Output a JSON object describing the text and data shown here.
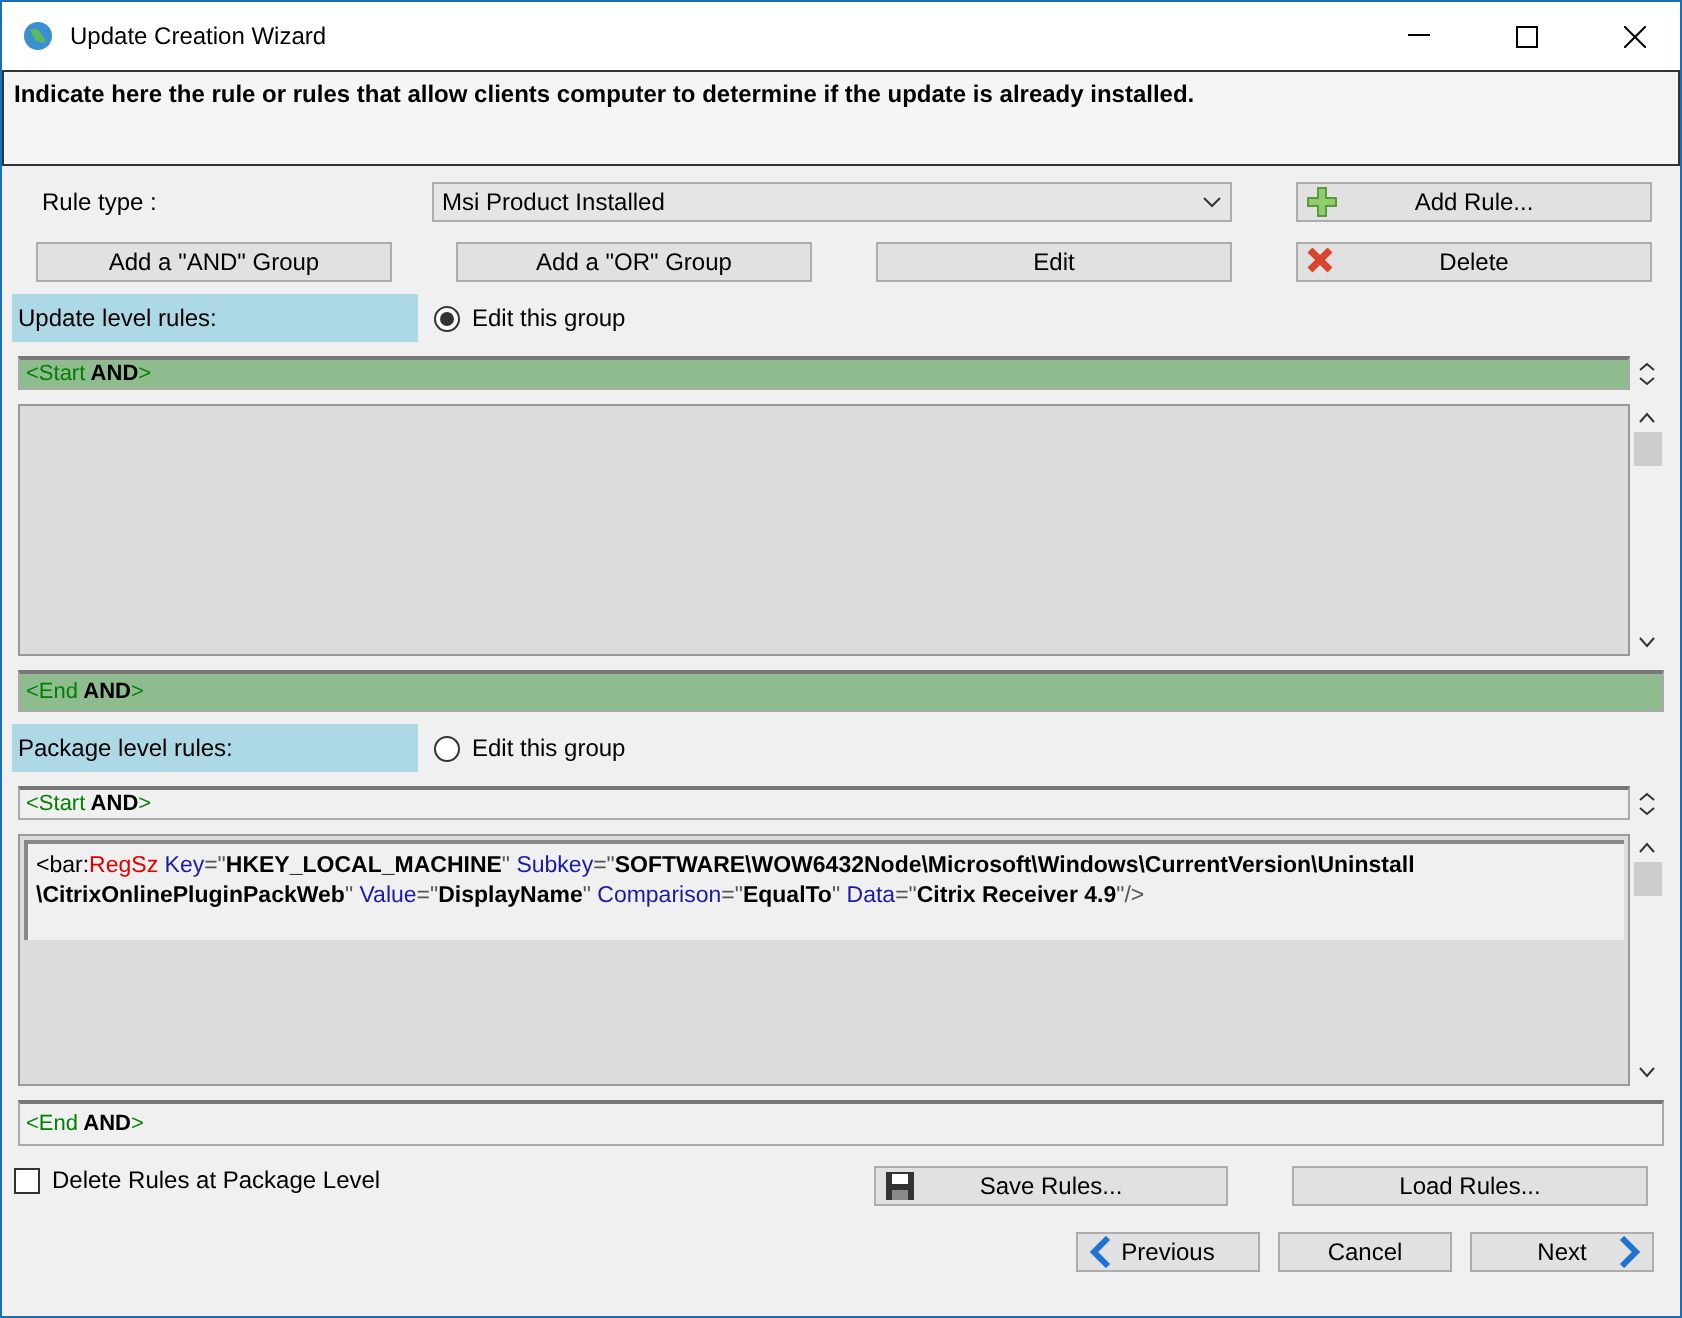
{
  "window": {
    "title": "Update Creation Wizard"
  },
  "instruction": "Indicate here the rule or rules that allow clients computer to determine if the update is already installed.",
  "rule_type": {
    "label": "Rule type :",
    "value": "Msi Product Installed"
  },
  "buttons": [
    {
      "label": "Add Rule..."
    },
    {
      "label": "Add a \"AND\" Group"
    },
    {
      "label": "Add a \"OR\" Group"
    },
    {
      "label": "Edit"
    },
    {
      "label": "Delete"
    }
  ],
  "groups": [
    {
      "label": "Update level rules:",
      "radio": "Edit this group",
      "selected": true,
      "start": [
        {
          "kind": "punct",
          "text": "<Start"
        },
        {
          "kind": "op",
          "text": " AND"
        },
        {
          "kind": "punct",
          "text": ">"
        }
      ],
      "end": [
        {
          "kind": "punct",
          "text": "<End"
        },
        {
          "kind": "op",
          "text": " AND"
        },
        {
          "kind": "punct",
          "text": ">"
        }
      ]
    },
    {
      "label": "Package level rules:",
      "radio": "Edit this group",
      "selected": false,
      "start": [
        {
          "kind": "punct",
          "text": "<Start"
        },
        {
          "kind": "op",
          "text": " AND"
        },
        {
          "kind": "punct",
          "text": ">"
        }
      ],
      "end": [
        {
          "kind": "punct",
          "text": "<End"
        },
        {
          "kind": "op",
          "text": " AND"
        },
        {
          "kind": "punct",
          "text": ">"
        }
      ],
      "rules": [
        [
          {
            "kind": "tag",
            "text": "<bar:"
          },
          {
            "kind": "type",
            "text": "RegSz"
          },
          {
            "kind": "attr",
            "text": " Key"
          },
          {
            "kind": "quote",
            "text": "=\""
          },
          {
            "kind": "value",
            "text": "HKEY_LOCAL_MACHINE"
          },
          {
            "kind": "quote",
            "text": "\""
          },
          {
            "kind": "attr",
            "text": " Subkey"
          },
          {
            "kind": "quote",
            "text": "=\""
          },
          {
            "kind": "value",
            "text": "SOFTWARE\\WOW6432Node\\Microsoft\\Windows\\CurrentVersion\\Uninstall \\CitrixOnlinePluginPackWeb"
          },
          {
            "kind": "quote",
            "text": "\""
          },
          {
            "kind": "attr",
            "text": " Value"
          },
          {
            "kind": "quote",
            "text": "=\""
          },
          {
            "kind": "value",
            "text": "DisplayName"
          },
          {
            "kind": "quote",
            "text": "\""
          },
          {
            "kind": "attr",
            "text": " Comparison"
          },
          {
            "kind": "quote",
            "text": "=\""
          },
          {
            "kind": "value",
            "text": "EqualTo"
          },
          {
            "kind": "quote",
            "text": "\""
          },
          {
            "kind": "attr",
            "text": " Data"
          },
          {
            "kind": "quote",
            "text": "=\""
          },
          {
            "kind": "value",
            "text": "Citrix Receiver 4.9"
          },
          {
            "kind": "quote",
            "text": "\"/>"
          }
        ]
      ]
    }
  ],
  "delete_option": {
    "label": "Delete Rules at Package Level",
    "checked": false
  },
  "file_buttons": [
    {
      "label": "Save Rules..."
    },
    {
      "label": "Load Rules..."
    }
  ],
  "nav_buttons": [
    {
      "label": "Previous"
    },
    {
      "label": "Cancel"
    },
    {
      "label": "Next"
    }
  ]
}
